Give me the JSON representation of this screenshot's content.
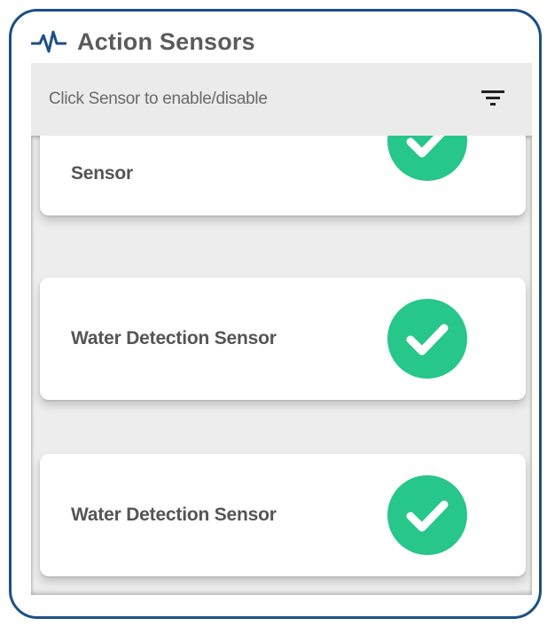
{
  "header": {
    "title": "Action Sensors",
    "icon": "pulse-icon"
  },
  "toolbar": {
    "hint": "Click Sensor to enable/disable",
    "filter_icon": "filter-icon"
  },
  "sensors": [
    {
      "label": "Sensor",
      "enabled": true
    },
    {
      "label": "Water Detection Sensor",
      "enabled": true
    },
    {
      "label": "Water Detection Sensor",
      "enabled": true
    }
  ],
  "colors": {
    "border": "#1b4f86",
    "accent": "#27c68a",
    "title": "#5b5b5b",
    "toolbar_bg": "#ebebeb"
  }
}
